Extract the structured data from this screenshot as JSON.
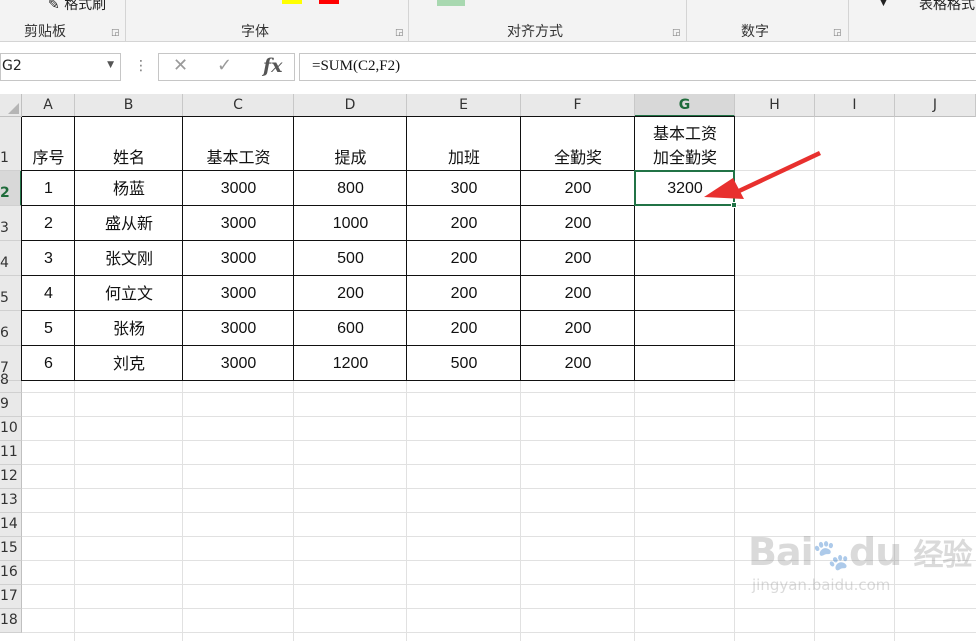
{
  "ribbon": {
    "groups": [
      {
        "label": "剪贴板"
      },
      {
        "label": "字体"
      },
      {
        "label": "对齐方式"
      },
      {
        "label": "数字"
      }
    ],
    "format_painter": "格式刷",
    "table_format": "表格格式",
    "colors": {
      "highlight": "#ffff00",
      "font_color": "#ff0000"
    }
  },
  "formula_bar": {
    "name_box": "G2",
    "cancel_icon": "✕",
    "enter_icon": "✓",
    "fx": "fx",
    "formula": "=SUM(C2,F2)"
  },
  "sheet": {
    "columns": [
      "A",
      "B",
      "C",
      "D",
      "E",
      "F",
      "G",
      "H",
      "I",
      "J"
    ],
    "rows": [
      "1",
      "2",
      "3",
      "4",
      "5",
      "6",
      "7",
      "8",
      "9",
      "10",
      "11",
      "12",
      "13",
      "14",
      "15",
      "16",
      "17",
      "18"
    ],
    "selected_cell": "G2",
    "header": [
      "序号",
      "姓名",
      "基本工资",
      "提成",
      "加班",
      "全勤奖",
      "基本工资",
      "加全勤奖"
    ],
    "data": [
      [
        "1",
        "杨蓝",
        "3000",
        "800",
        "300",
        "200",
        "3200"
      ],
      [
        "2",
        "盛从新",
        "3000",
        "1000",
        "200",
        "200",
        ""
      ],
      [
        "3",
        "张文刚",
        "3000",
        "500",
        "200",
        "200",
        ""
      ],
      [
        "4",
        "何立文",
        "3000",
        "200",
        "200",
        "200",
        ""
      ],
      [
        "5",
        "张杨",
        "3000",
        "600",
        "200",
        "200",
        ""
      ],
      [
        "6",
        "刘克",
        "3000",
        "1200",
        "500",
        "200",
        ""
      ]
    ]
  },
  "annotation": {
    "arrow_color": "#e8302e"
  },
  "watermark": {
    "brand": "Bai",
    "brand2": "du",
    "cn": "经验",
    "url": "jingyan.baidu.com"
  }
}
